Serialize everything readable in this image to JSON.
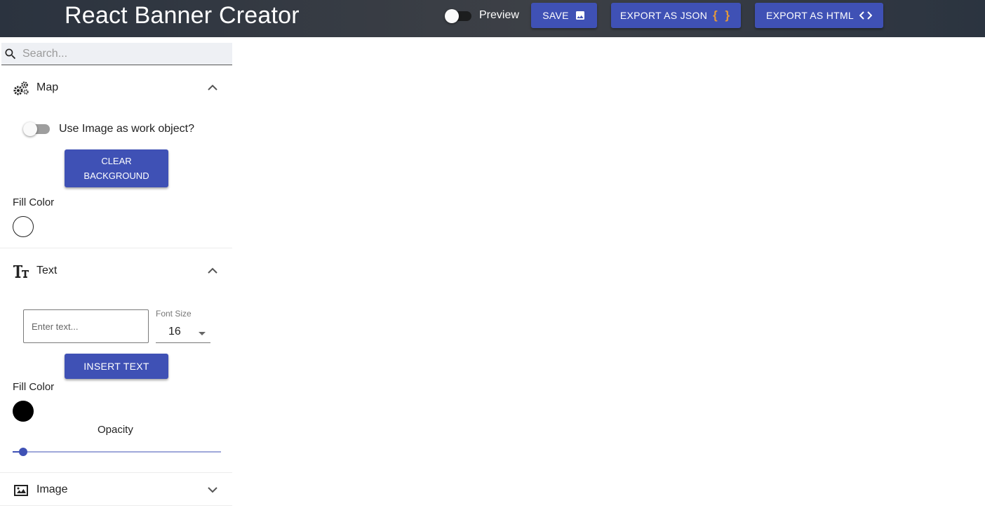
{
  "header": {
    "title": "React Banner Creator",
    "preview_label": "Preview",
    "preview_on": false,
    "save_label": "SAVE",
    "save_icon": "image-icon",
    "export_json_label": "EXPORT AS JSON",
    "export_json_icon": "{ }",
    "export_html_label": "EXPORT AS HTML",
    "export_html_icon": "<>"
  },
  "sidebar": {
    "search": {
      "placeholder": "Search...",
      "value": "",
      "icon": "search-icon"
    },
    "sections": {
      "map": {
        "title": "Map",
        "icon": "gears-icon",
        "expanded": true,
        "toggle_label": "Use Image as work object?",
        "toggle_on": false,
        "clear_button_line1": "CLEAR",
        "clear_button_line2": "BACKGROUND",
        "fill_color_label": "Fill Color",
        "fill_color": "#ffffff"
      },
      "text": {
        "title": "Text",
        "icon": "text-size-icon",
        "expanded": true,
        "input_placeholder": "Enter text...",
        "input_value": "",
        "font_size_label": "Font Size",
        "font_size_value": "16",
        "insert_button": "INSERT TEXT",
        "fill_color_label": "Fill Color",
        "fill_color": "#000000",
        "opacity_label": "Opacity",
        "opacity_fraction": 0.05
      },
      "image": {
        "title": "Image",
        "icon": "image-icon",
        "expanded": false
      }
    }
  },
  "colors": {
    "primary": "#3f51b5",
    "header_bg": "#2f3640",
    "accent_json": "#e59a3a"
  }
}
